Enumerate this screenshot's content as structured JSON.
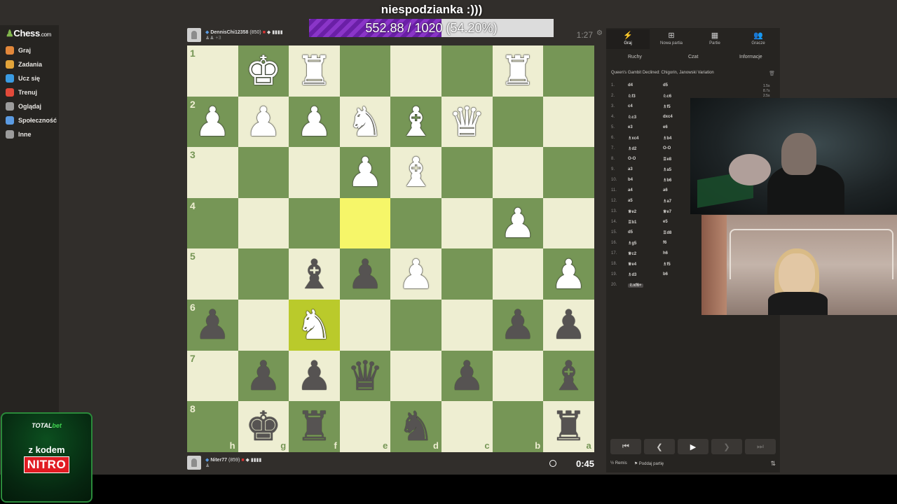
{
  "overlay": {
    "title": "niespodzianka :)))",
    "progress_text": "552.88 / 1020 (54.20%)",
    "progress_fraction": 0.542
  },
  "sidebar": {
    "logo": "Chess",
    "logo_suffix": ".com",
    "items": [
      {
        "label": "Graj",
        "color": "#e2873a"
      },
      {
        "label": "Zadania",
        "color": "#e2a43a"
      },
      {
        "label": "Ucz się",
        "color": "#3a9be2"
      },
      {
        "label": "Trenuj",
        "color": "#e24a3a"
      },
      {
        "label": "Oglądaj",
        "color": "#9c9c9c"
      },
      {
        "label": "Społeczność",
        "color": "#5b9be2"
      },
      {
        "label": "Inne",
        "color": "#9c9c9c"
      }
    ]
  },
  "top_player": {
    "name": "DennisChi12358",
    "rating": "(850)",
    "sub": "+3",
    "clock": "1:27"
  },
  "bottom_player": {
    "name": "Niter77",
    "rating": "(859)",
    "clock": "0:45"
  },
  "board": {
    "ranks": [
      "1",
      "2",
      "3",
      "4",
      "5",
      "6",
      "7",
      "8"
    ],
    "files": [
      "h",
      "g",
      "f",
      "e",
      "d",
      "c",
      "b",
      "a"
    ],
    "rows": [
      [
        "",
        "wK",
        "wR",
        "",
        "",
        "",
        "wR",
        ""
      ],
      [
        "wP",
        "wP",
        "wP",
        "wN",
        "wB",
        "wQ",
        "",
        ""
      ],
      [
        "",
        "",
        "",
        "wP",
        "wB",
        "",
        "",
        ""
      ],
      [
        "",
        "",
        "",
        "",
        "",
        "",
        "wP",
        ""
      ],
      [
        "",
        "",
        "bB",
        "bP",
        "wP",
        "",
        "",
        "wP"
      ],
      [
        "bP",
        "",
        "wN",
        "",
        "",
        "",
        "bP",
        "bP"
      ],
      [
        "",
        "bP",
        "bP",
        "bQ",
        "",
        "bP",
        "",
        "bB"
      ],
      [
        "",
        "bK",
        "bR",
        "",
        "bN",
        "",
        "",
        "bR"
      ]
    ],
    "highlights": [
      [
        3,
        3
      ],
      [
        5,
        2
      ]
    ]
  },
  "panel": {
    "tabs": [
      {
        "label": "Graj",
        "icon": "⚡"
      },
      {
        "label": "Nowa partia",
        "icon": "⊞"
      },
      {
        "label": "Partie",
        "icon": "▦"
      },
      {
        "label": "Gracze",
        "icon": "👥"
      }
    ],
    "subtabs": [
      "Ruchy",
      "Czat",
      "Informacje"
    ],
    "opening": "Queen's Gambit Declined: Chigorin, Janowski Variation",
    "moves": [
      [
        "1.",
        "d4",
        "d5"
      ],
      [
        "2.",
        "♘f3",
        "♘c6"
      ],
      [
        "3.",
        "c4",
        "♗f5"
      ],
      [
        "4.",
        "♘c3",
        "dxc4"
      ],
      [
        "5.",
        "e3",
        "e6"
      ],
      [
        "6.",
        "♗xc4",
        "♗b4"
      ],
      [
        "7.",
        "♗d2",
        "O-O"
      ],
      [
        "8.",
        "O-O",
        "♖e8"
      ],
      [
        "9.",
        "a3",
        "♗a5"
      ],
      [
        "10.",
        "b4",
        "♗b6"
      ],
      [
        "11.",
        "a4",
        "a6"
      ],
      [
        "12.",
        "a5",
        "♗a7"
      ],
      [
        "13.",
        "♕e2",
        "♕e7"
      ],
      [
        "14.",
        "♖b1",
        "e5"
      ],
      [
        "15.",
        "d5",
        "♖d8"
      ],
      [
        "16.",
        "♗g5",
        "f6"
      ],
      [
        "17.",
        "♕c2",
        "h6"
      ],
      [
        "18.",
        "♕e4",
        "♗f5"
      ],
      [
        "19.",
        "♗d3",
        "b6"
      ],
      [
        "20.",
        "♘xf6+",
        ""
      ]
    ],
    "time_bars": [
      "1.5s",
      "8.7s",
      "2.5s"
    ],
    "draw_label": "Remis",
    "resign_label": "Poddaj partię"
  },
  "promo": {
    "brand_a": "TOTAL",
    "brand_b": "bet",
    "line": "z kodem",
    "code": "NITRO"
  }
}
